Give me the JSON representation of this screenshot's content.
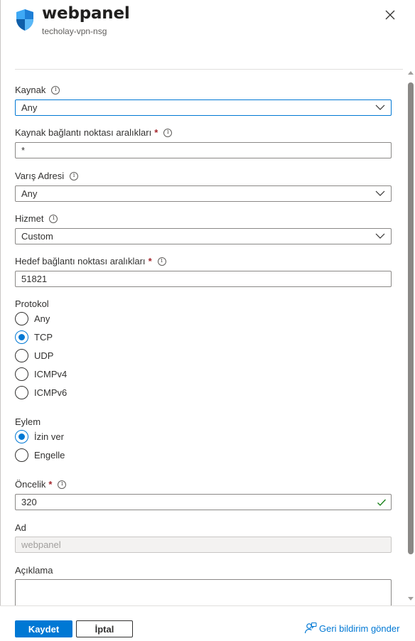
{
  "header": {
    "title": "webpanel",
    "subtitle": "techolay-vpn-nsg",
    "icon": "shield-icon",
    "close_icon": "close-icon"
  },
  "form": {
    "source": {
      "label": "Kaynak",
      "value": "Any"
    },
    "source_port": {
      "label": "Kaynak bağlantı noktası aralıkları",
      "required_mark": "*",
      "value": "*"
    },
    "destination": {
      "label": "Varış Adresi",
      "value": "Any"
    },
    "service": {
      "label": "Hizmet",
      "value": "Custom"
    },
    "dest_port": {
      "label": "Hedef bağlantı noktası aralıkları",
      "required_mark": "*",
      "value": "51821"
    },
    "protocol": {
      "label": "Protokol",
      "options": [
        "Any",
        "TCP",
        "UDP",
        "ICMPv4",
        "ICMPv6"
      ],
      "selected": "TCP"
    },
    "action": {
      "label": "Eylem",
      "options": [
        "İzin ver",
        "Engelle"
      ],
      "selected": "İzin ver"
    },
    "priority": {
      "label": "Öncelik",
      "required_mark": "*",
      "value": "320"
    },
    "name": {
      "label": "Ad",
      "value": "webpanel"
    },
    "description": {
      "label": "Açıklama",
      "value": ""
    }
  },
  "footer": {
    "save_label": "Kaydet",
    "cancel_label": "İptal",
    "feedback_label": "Geri bildirim gönder"
  },
  "colors": {
    "accent": "#0078d4",
    "required": "#a4262c",
    "valid": "#107c10",
    "shield_dark": "#0f5ea8",
    "shield_light": "#3fa9f5"
  }
}
